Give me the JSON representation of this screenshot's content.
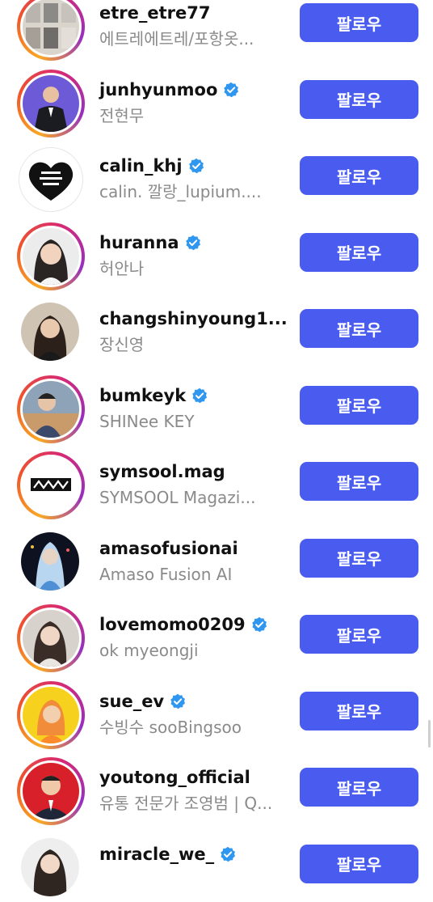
{
  "button_label": "팔로우",
  "accent_color": "#4a5cf0",
  "verified_color": "#2f97f0",
  "users": [
    {
      "username": "etre_etre77",
      "name": "에트레에트레/포항옷...",
      "verified": false,
      "story": true,
      "avatar_icon": "clothing-photo-avatar"
    },
    {
      "username": "junhyunmoo",
      "name": "전현무",
      "verified": true,
      "story": true,
      "avatar_icon": "person-in-suit-avatar"
    },
    {
      "username": "calin_khj",
      "name": "calin. 깔랑_lupium....",
      "verified": true,
      "story": false,
      "avatar_icon": "heart-logo-avatar"
    },
    {
      "username": "huranna",
      "name": "허안나",
      "verified": true,
      "story": true,
      "avatar_icon": "woman-portrait-avatar"
    },
    {
      "username": "changshinyoung1...",
      "name": "장신영",
      "verified": false,
      "story": false,
      "avatar_icon": "woman-portrait-avatar"
    },
    {
      "username": "bumkeyk",
      "name": "SHINee KEY",
      "verified": true,
      "story": true,
      "avatar_icon": "man-portrait-avatar"
    },
    {
      "username": "symsool.mag",
      "name": "SYMSOOL Magazi...",
      "verified": false,
      "story": true,
      "avatar_icon": "magazine-logo-avatar"
    },
    {
      "username": "amasofusionai",
      "name": "Amaso Fusion AI",
      "verified": false,
      "story": false,
      "avatar_icon": "ai-art-avatar"
    },
    {
      "username": "lovemomo0209",
      "name": "ok myeongji",
      "verified": true,
      "story": true,
      "avatar_icon": "woman-portrait-avatar"
    },
    {
      "username": "sue_ev",
      "name": "수빙수 sooBingsoo",
      "verified": true,
      "story": true,
      "avatar_icon": "woman-yellow-avatar"
    },
    {
      "username": "youtong_official",
      "name": "유통 전문가 조영범 | Q...",
      "verified": false,
      "story": true,
      "avatar_icon": "man-red-background-avatar"
    },
    {
      "username": "miracle_we_",
      "name": "",
      "verified": true,
      "story": false,
      "avatar_icon": "woman-portrait-avatar"
    }
  ]
}
